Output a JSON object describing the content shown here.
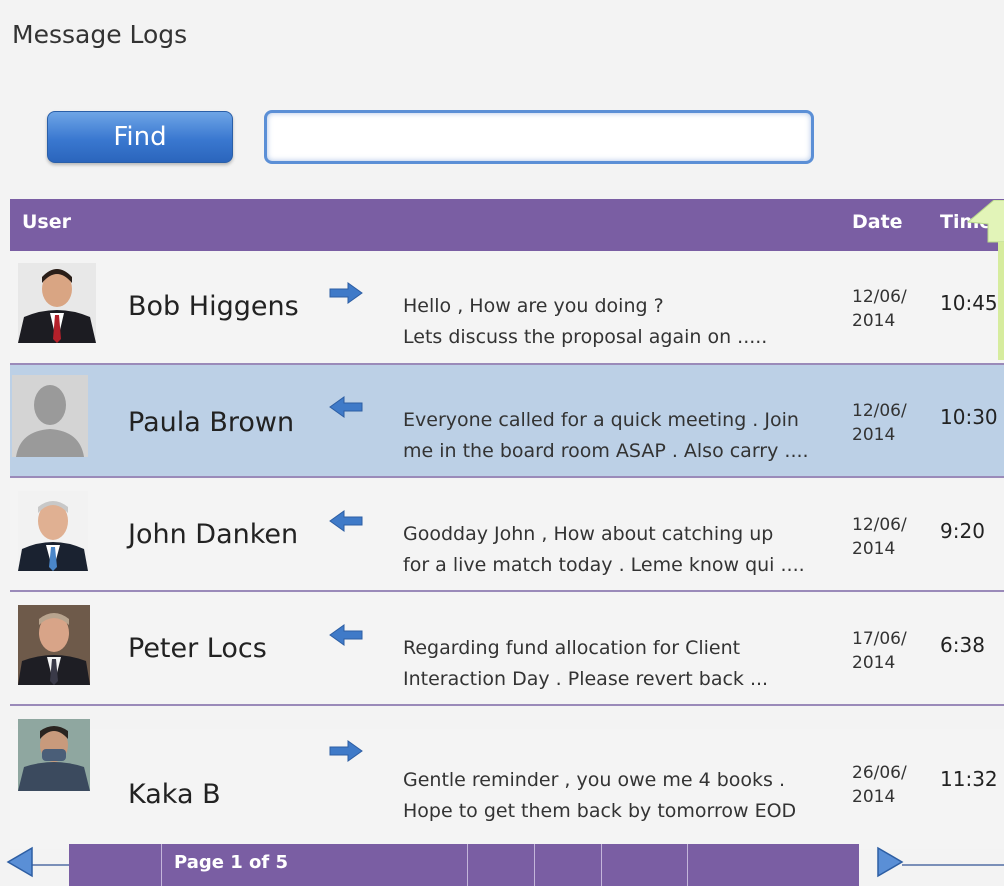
{
  "page": {
    "title": "Message Logs"
  },
  "search": {
    "button_label": "Find",
    "value": ""
  },
  "table": {
    "headers": {
      "user": "User",
      "date": "Date",
      "time": "Time"
    },
    "rows": [
      {
        "name": "Bob Higgens",
        "direction": "outgoing",
        "message_line1": "Hello , How are you doing ?",
        "message_line2": "Lets discuss the proposal again on  .....",
        "date_line1": "12/06/",
        "date_line2": "2014",
        "time": "10:45",
        "avatar": "photo-man-red-tie"
      },
      {
        "name": "Paula Brown",
        "direction": "incoming",
        "message_line1": "Everyone called for a quick meeting . Join",
        "message_line2": "me in the board room ASAP . Also carry ....",
        "date_line1": "12/06/",
        "date_line2": "2014",
        "time": "10:30",
        "avatar": "placeholder-silhouette"
      },
      {
        "name": "John Danken",
        "direction": "incoming",
        "message_line1": "Goodday John ,  How about catching up",
        "message_line2": "for a live match today . Leme know qui ....",
        "date_line1": "12/06/",
        "date_line2": "2014",
        "time": "9:20",
        "avatar": "photo-man-blue-tie"
      },
      {
        "name": "Peter Locs",
        "direction": "incoming",
        "message_line1": "Regarding fund allocation for Client",
        "message_line2": "Interaction Day . Please revert back ...",
        "date_line1": "17/06/",
        "date_line2": "2014",
        "time": "6:38",
        "avatar": "photo-man-dark-suit"
      },
      {
        "name": "Kaka  B",
        "direction": "outgoing",
        "message_line1": "Gentle reminder , you owe me 4 books .",
        "message_line2": "Hope to get them back by tomorrow  EOD",
        "date_line1": "26/06/",
        "date_line2": "2014",
        "time": "11:32",
        "avatar": "photo-young-man"
      }
    ]
  },
  "pagination": {
    "label": "Page 1 of 5"
  },
  "colors": {
    "header": "#7a5ea3",
    "selected_row": "#bcd0e6",
    "arrow": "#3f7ac8",
    "button": "#3a78d0"
  }
}
